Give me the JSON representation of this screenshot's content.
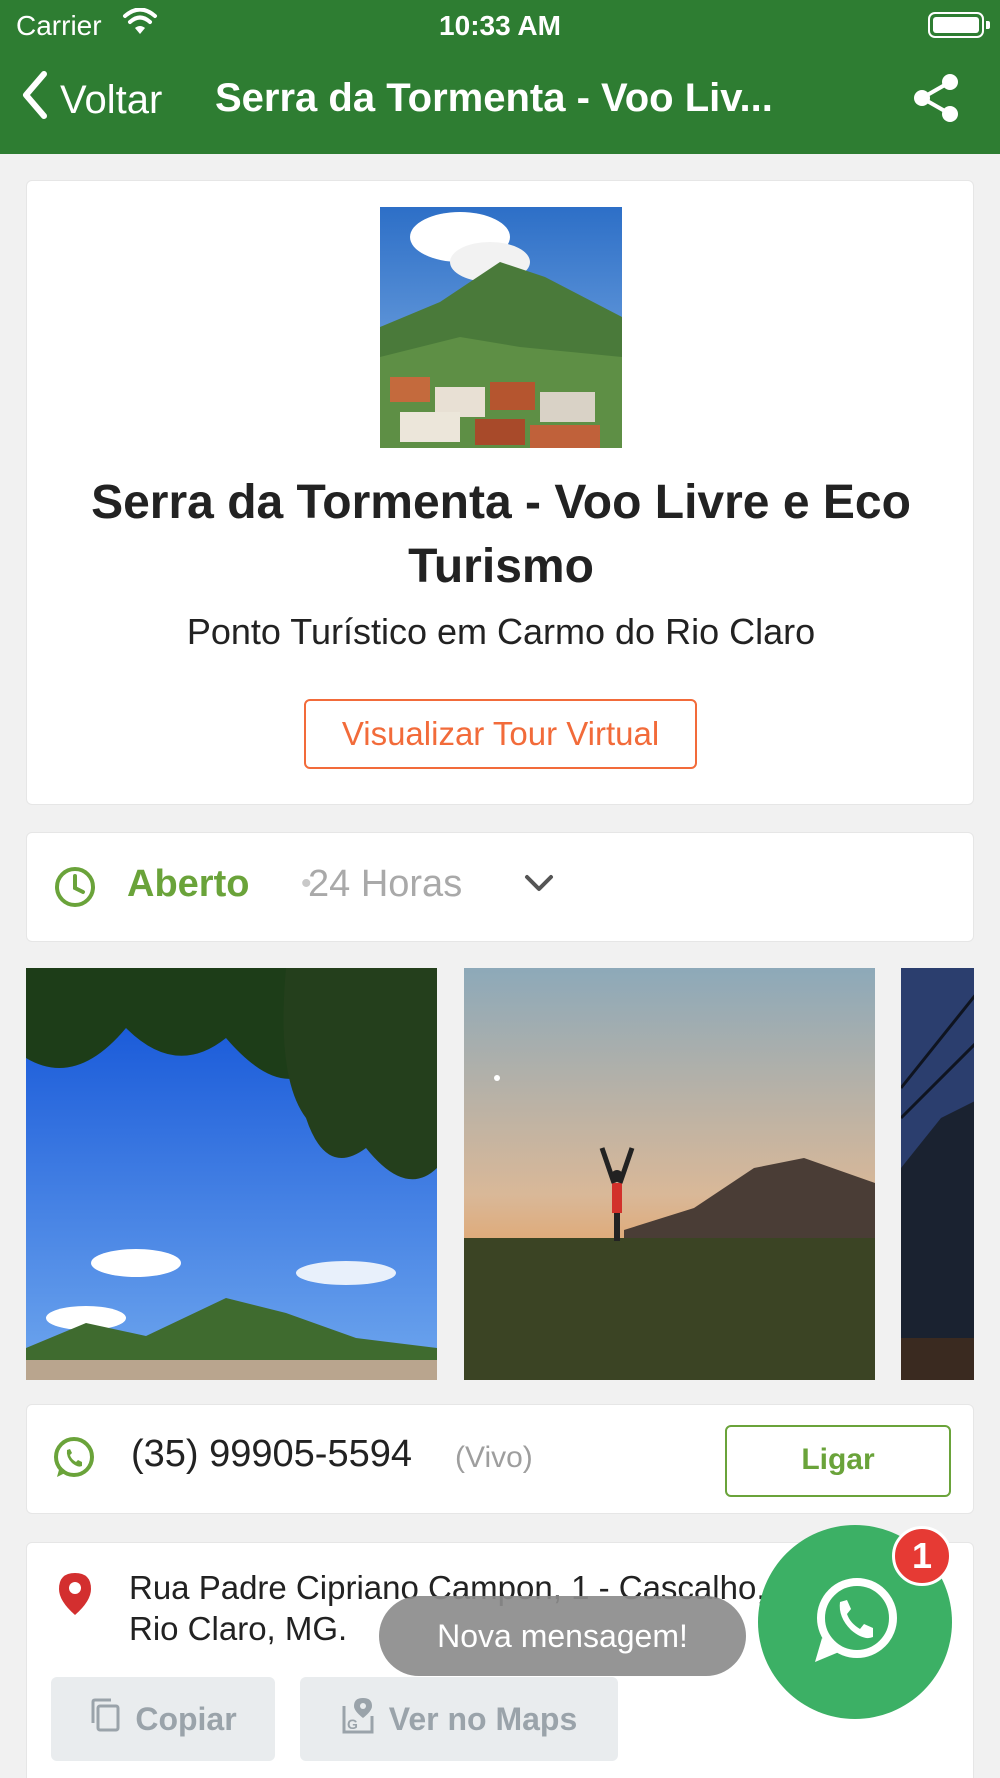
{
  "status_bar": {
    "carrier": "Carrier",
    "time": "10:33 AM"
  },
  "nav": {
    "back_label": "Voltar",
    "title": "Serra da Tormenta - Voo Liv..."
  },
  "place": {
    "name": "Serra da Tormenta - Voo Livre e Eco Turismo",
    "subtitle": "Ponto Turístico em Carmo do Rio Claro",
    "tour_button": "Visualizar Tour Virtual"
  },
  "hours": {
    "status": "Aberto",
    "separator": "•",
    "schedule": "24 Horas"
  },
  "contact": {
    "phone": "(35) 99905-5594",
    "carrier": "(Vivo)",
    "call_button": "Ligar"
  },
  "address": {
    "text": "Rua Padre Cipriano Campon, 1 - Cascalho, Carmo do Rio Claro, MG.",
    "copy_button": "Copiar",
    "maps_button": "Ver no Maps"
  },
  "toast": "Nova mensagem!",
  "whatsapp_fab": {
    "badge_count": "1"
  },
  "colors": {
    "primary": "#2e7d32",
    "accent_orange": "#f26b3a",
    "open_green": "#6aa33a",
    "whatsapp": "#3cb065",
    "badge_red": "#e63a34"
  },
  "icons": [
    "chevron-left-icon",
    "share-icon",
    "clock-icon",
    "chevron-down-icon",
    "whatsapp-icon",
    "map-pin-icon",
    "copy-icon",
    "map-icon"
  ]
}
